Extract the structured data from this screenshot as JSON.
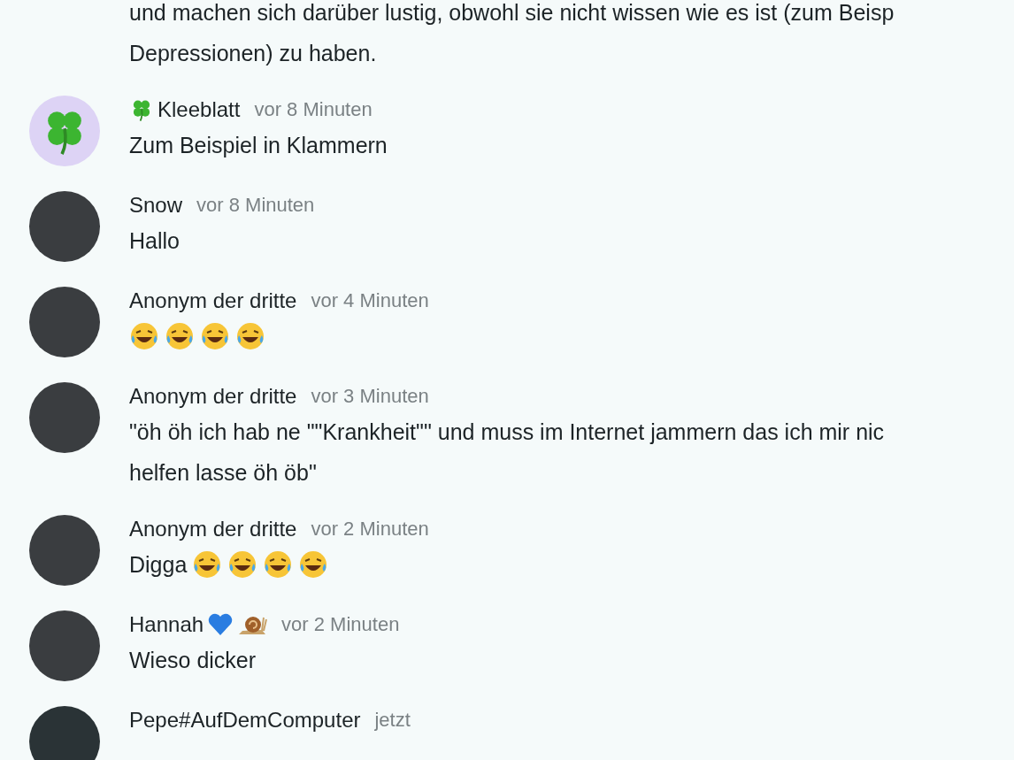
{
  "messages": [
    {
      "lines": [
        "und machen sich darüber lustig, obwohl sie nicht wissen wie es ist (zum Beisp",
        "Depressionen) zu haben."
      ]
    },
    {
      "avatar": {
        "kind": "clover"
      },
      "author": "Kleeblatt",
      "author_icons": [
        {
          "kind": "clover"
        }
      ],
      "time": "vor 8 Minuten",
      "lines": [
        "Zum Beispiel in Klammern"
      ]
    },
    {
      "avatar": {
        "kind": "photo"
      },
      "author": "Snow",
      "time": "vor 8 Minuten",
      "lines": [
        "Hallo"
      ]
    },
    {
      "avatar": {
        "kind": "photo"
      },
      "author": "Anonym der dritte",
      "time": "vor 4 Minuten",
      "emojis": [
        {
          "kind": "tears-of-joy"
        },
        {
          "kind": "tears-of-joy"
        },
        {
          "kind": "tears-of-joy"
        },
        {
          "kind": "tears-of-joy"
        }
      ]
    },
    {
      "avatar": {
        "kind": "photo"
      },
      "author": "Anonym der dritte",
      "time": "vor 3 Minuten",
      "lines": [
        "\"öh öh ich hab ne \"\"Krankheit\"\" und muss im Internet jammern das ich mir nic",
        "helfen lasse öh öb\""
      ]
    },
    {
      "avatar": {
        "kind": "photo"
      },
      "author": "Anonym der dritte",
      "time": "vor 2 Minuten",
      "lines": [
        "Digga"
      ],
      "emojis": [
        {
          "kind": "tears-of-joy"
        },
        {
          "kind": "tears-of-joy"
        },
        {
          "kind": "tears-of-joy"
        },
        {
          "kind": "tears-of-joy"
        }
      ]
    },
    {
      "avatar": {
        "kind": "photo"
      },
      "author": "Hannah",
      "author_icons_after": [
        {
          "kind": "heart"
        },
        {
          "kind": "snail"
        }
      ],
      "time": "vor 2 Minuten",
      "lines": [
        "Wieso dicker"
      ]
    },
    {
      "avatar": {
        "kind": "dark"
      },
      "author": "Pepe#AufDemComputer",
      "time": "jetzt"
    }
  ]
}
